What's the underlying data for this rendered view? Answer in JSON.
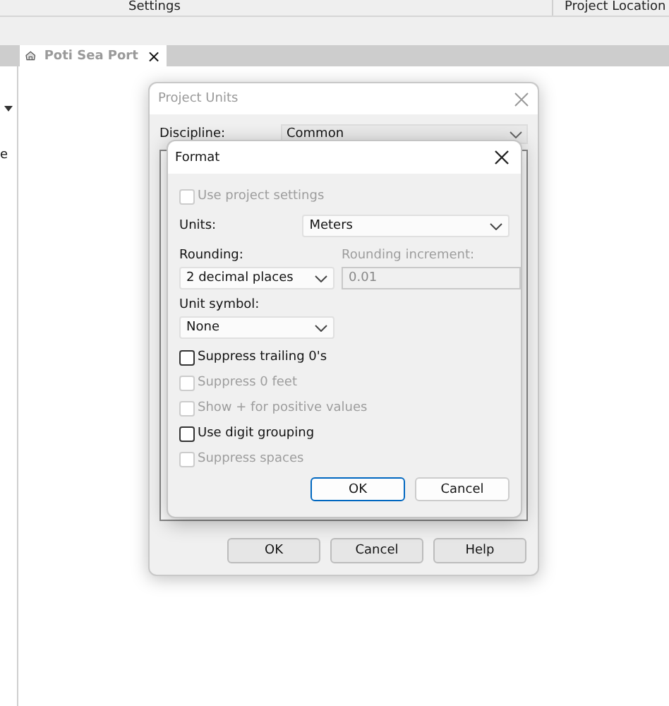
{
  "ribbon": {
    "panels": [
      {
        "label": "Settings"
      },
      {
        "label": "Project Location"
      }
    ]
  },
  "left_panel": {
    "label": "e"
  },
  "view_tab": {
    "label": "Poti Sea Port",
    "close": "×"
  },
  "project_units": {
    "title": "Project Units",
    "discipline_label": "Discipline:",
    "discipline_value": "Common",
    "buttons": [
      "OK",
      "Cancel",
      "Help"
    ]
  },
  "format": {
    "title": "Format",
    "use_project_settings": {
      "label": "Use project settings",
      "checked": false,
      "disabled": true
    },
    "units_label": "Units:",
    "units_value": "Meters",
    "rounding_label": "Rounding:",
    "rounding_value": "2 decimal places",
    "increment_label": "Rounding increment:",
    "increment_value": "0.01",
    "unit_symbol_label": "Unit symbol:",
    "unit_symbol_value": "None",
    "options": [
      {
        "label": "Suppress trailing 0's",
        "checked": false,
        "disabled": false
      },
      {
        "label": "Suppress 0 feet",
        "checked": false,
        "disabled": true
      },
      {
        "label": "Show + for positive values",
        "checked": false,
        "disabled": true
      },
      {
        "label": "Use digit grouping",
        "checked": false,
        "disabled": false
      },
      {
        "label": "Suppress spaces",
        "checked": false,
        "disabled": true
      }
    ],
    "buttons": [
      {
        "label": "OK",
        "selected": true
      },
      {
        "label": "Cancel",
        "selected": false
      }
    ]
  }
}
